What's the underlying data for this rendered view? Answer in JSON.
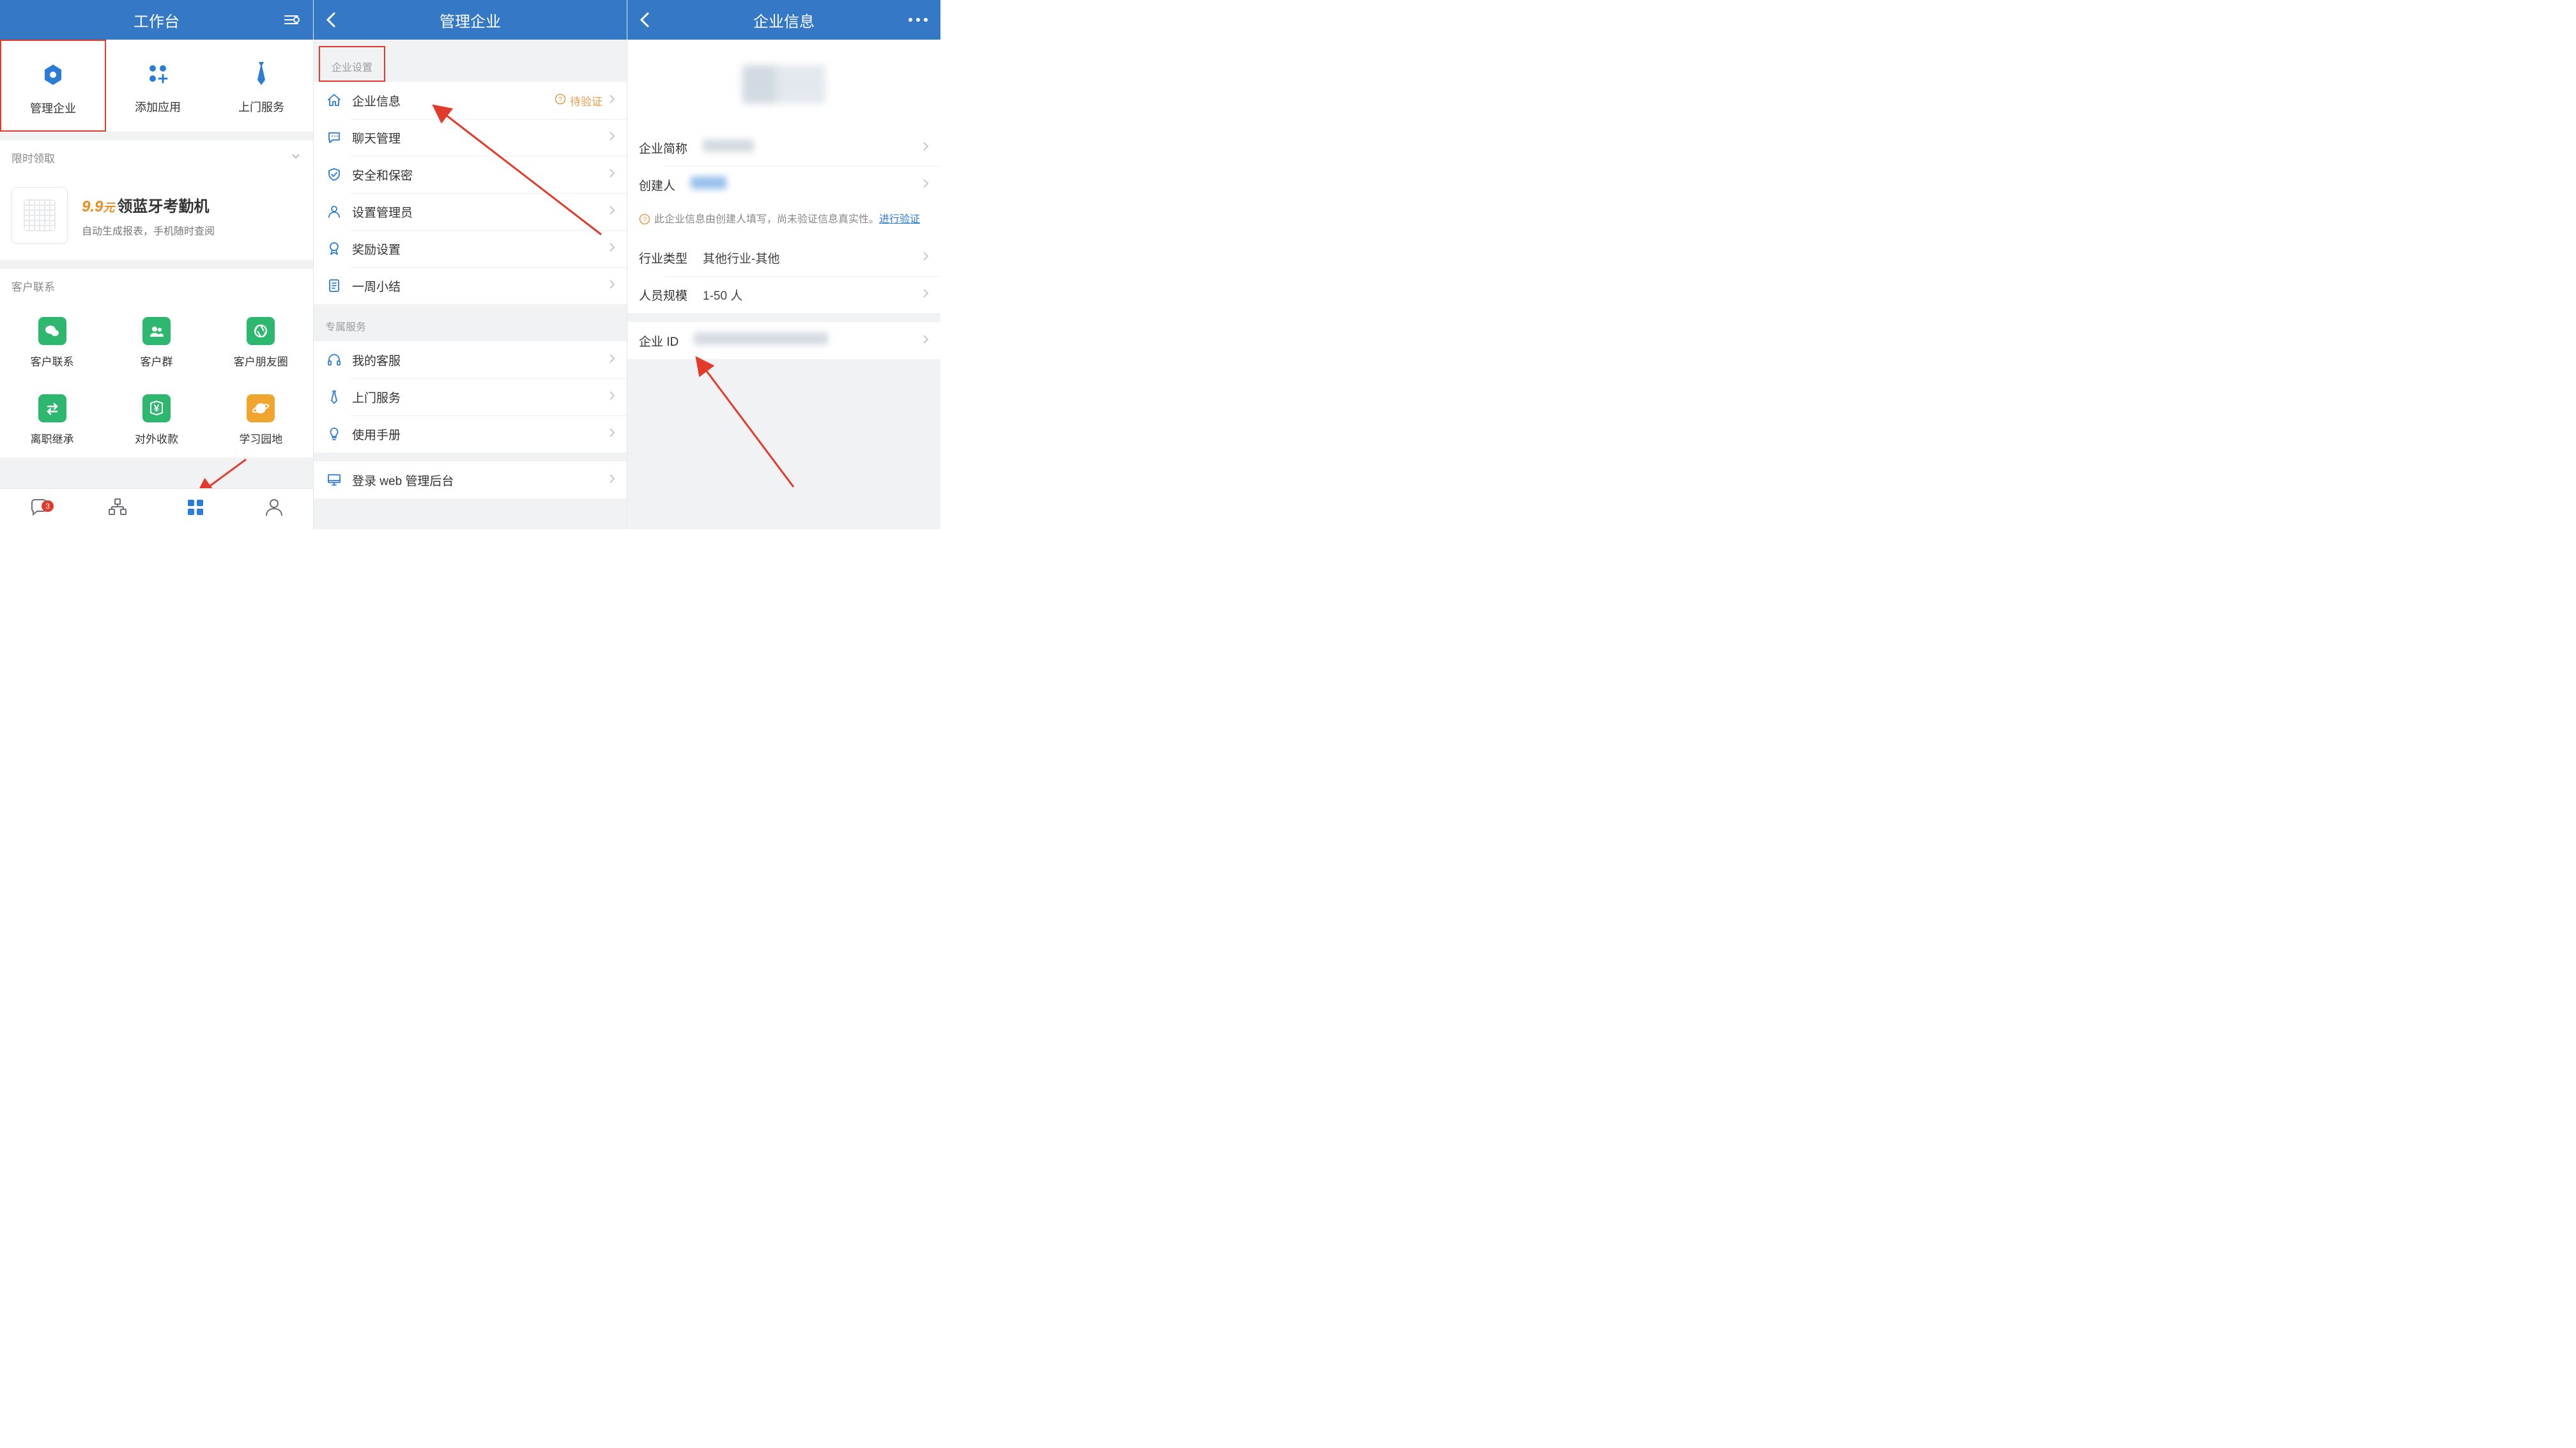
{
  "colors": {
    "brand": "#3478c6",
    "highlight": "#e33b2b",
    "green": "#2eb76f",
    "yellow": "#f0a62e",
    "arrow": "#e33b2b"
  },
  "screen1": {
    "title": "工作台",
    "topGrid": [
      {
        "icon": "gear-hex-icon",
        "label": "管理企业",
        "highlight": true
      },
      {
        "icon": "apps-add-icon",
        "label": "添加应用"
      },
      {
        "icon": "tie-icon",
        "label": "上门服务"
      }
    ],
    "limitedSection": {
      "title": "限时领取"
    },
    "promo": {
      "price": "9.9",
      "unit": "元",
      "titleRest": "领蓝牙考勤机",
      "subtitle": "自动生成报表，手机随时查阅"
    },
    "customerSection": {
      "title": "客户联系",
      "items": [
        {
          "icon": "wechat-icon",
          "color": "green",
          "label": "客户联系"
        },
        {
          "icon": "group-icon",
          "color": "green",
          "label": "客户群"
        },
        {
          "icon": "aperture-icon",
          "color": "green",
          "label": "客户朋友圈"
        },
        {
          "icon": "transfer-icon",
          "color": "green",
          "label": "离职继承"
        },
        {
          "icon": "cny-icon",
          "color": "green",
          "label": "对外收款"
        },
        {
          "icon": "planet-icon",
          "color": "yellow",
          "label": "学习园地"
        }
      ]
    },
    "tabbar": {
      "badge": "3"
    }
  },
  "screen2": {
    "title": "管理企业",
    "section1": {
      "header": "企业设置",
      "rows": [
        {
          "icon": "house-icon",
          "label": "企业信息",
          "note": "待验证",
          "noteWarn": true
        },
        {
          "icon": "chat-bubble-icon",
          "label": "聊天管理"
        },
        {
          "icon": "shield-icon",
          "label": "安全和保密"
        },
        {
          "icon": "person-icon",
          "label": "设置管理员"
        },
        {
          "icon": "medal-icon",
          "label": "奖励设置"
        },
        {
          "icon": "note-icon",
          "label": "一周小结"
        }
      ]
    },
    "section2": {
      "header": "专属服务",
      "rows": [
        {
          "icon": "headset-icon",
          "label": "我的客服"
        },
        {
          "icon": "tie-outline-icon",
          "label": "上门服务"
        },
        {
          "icon": "bulb-icon",
          "label": "使用手册"
        }
      ]
    },
    "section3": {
      "rows": [
        {
          "icon": "monitor-icon",
          "label": "登录 web 管理后台"
        }
      ]
    }
  },
  "screen3": {
    "title": "企业信息",
    "rows1": [
      {
        "label": "企业简称",
        "valueBlur": true,
        "blurW": 80
      },
      {
        "label": "创建人",
        "valueBlur": true,
        "blurW": 56,
        "blurColor": "#6ea6e6"
      }
    ],
    "notice": {
      "text": "此企业信息由创建人填写，尚未验证信息真实性。",
      "linkText": "进行验证"
    },
    "rows2": [
      {
        "label": "行业类型",
        "value": "其他行业-其他"
      },
      {
        "label": "人员规模",
        "value": "1-50 人"
      }
    ],
    "rows3": [
      {
        "label": "企业 ID",
        "valueBlur": true,
        "blurW": 210
      }
    ]
  }
}
